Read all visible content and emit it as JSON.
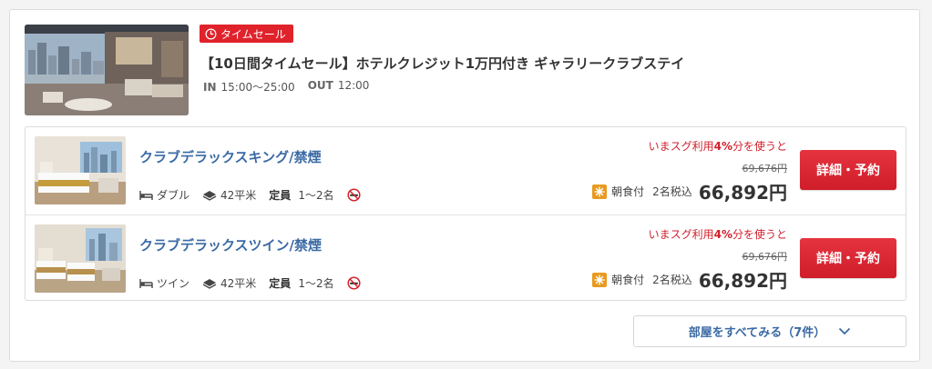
{
  "plan": {
    "badge": "タイムセール",
    "title": "【10日間タイムセール】ホテルクレジット1万円付き ギャラリークラブステイ",
    "checkin_label": "IN",
    "checkin_value": "15:00〜25:00",
    "checkout_label": "OUT",
    "checkout_value": "12:00"
  },
  "rooms": [
    {
      "name": "クラブデラックスキング/禁煙",
      "bed": "ダブル",
      "size": "42平米",
      "capacity_label": "定員",
      "capacity": "1〜2名",
      "promo_prefix": "いまスグ利用",
      "promo_pct": "4%",
      "promo_suffix": "分を使うと",
      "old_price": "69,676円",
      "meal": "朝食付",
      "pax": "2名税込",
      "price": "66,892円",
      "button": "詳細・予約"
    },
    {
      "name": "クラブデラックスツイン/禁煙",
      "bed": "ツイン",
      "size": "42平米",
      "capacity_label": "定員",
      "capacity": "1〜2名",
      "promo_prefix": "いまスグ利用",
      "promo_pct": "4%",
      "promo_suffix": "分を使うと",
      "old_price": "69,676円",
      "meal": "朝食付",
      "pax": "2名税込",
      "price": "66,892円",
      "button": "詳細・予約"
    }
  ],
  "footer": {
    "see_all": "部屋をすべてみる（7件）"
  },
  "icons": {
    "badge": "clock-icon",
    "bed": "bed-icon",
    "size": "floor-area-icon",
    "no_smoking": "no-smoking-icon",
    "meal": "meal-icon",
    "chevron": "chevron-down-icon"
  },
  "colors": {
    "sale_red": "#e0222b",
    "link_blue": "#3b6aa4",
    "promo_red": "#d21e2b",
    "button_red": "#d9252f",
    "meal_orange": "#e89a20"
  }
}
